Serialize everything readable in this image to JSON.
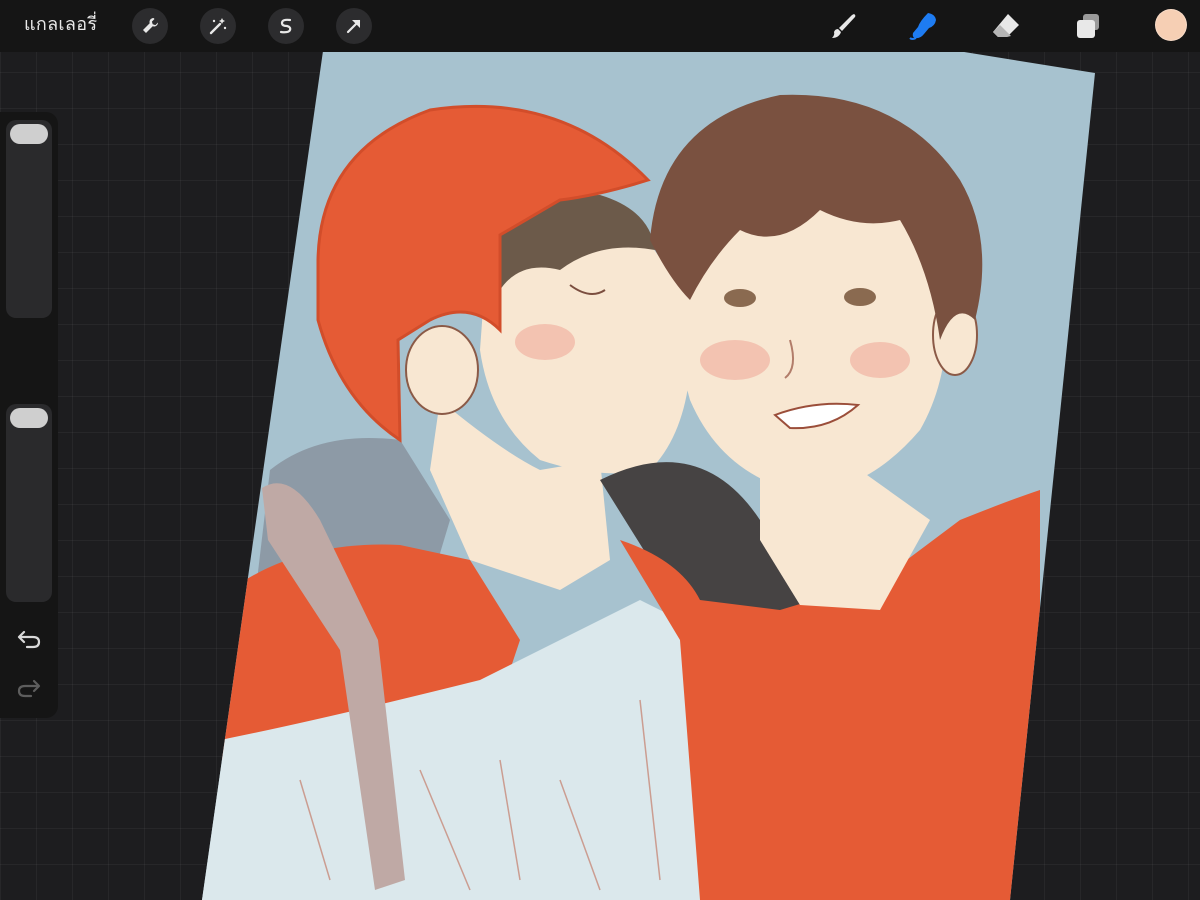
{
  "toolbar": {
    "gallery_label": "แกลเลอรี่",
    "left_tools": [
      "wrench-icon",
      "magic-wand-icon",
      "selection-s-icon",
      "transform-arrow-icon"
    ],
    "right_tools": [
      "brush-icon",
      "smudge-icon",
      "eraser-icon",
      "layers-icon"
    ],
    "active_tool": "smudge",
    "active_color": "#f6cfb4",
    "accent_color": "#1e7cf2"
  },
  "sidebar": {
    "brush_size_level": 0.98,
    "opacity_level": 0.95,
    "modify_button": "square-icon",
    "undo": "undo-icon",
    "redo": "redo-icon"
  },
  "canvas": {
    "background_color": "#a7c2cf",
    "palette": {
      "orange_red": "#e55b35",
      "skin": "#f8e7d2",
      "hair_brown": "#7a5140",
      "shirt_light": "#dbe8ec",
      "hood_dark": "#464343",
      "strap": "#bfa9a5"
    }
  }
}
